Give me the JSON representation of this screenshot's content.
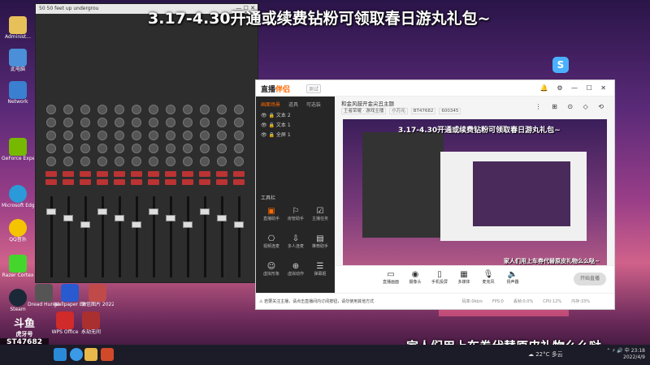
{
  "overlay": {
    "top_banner": "3.17-4.30开通或续费钻粉可领取春日游丸礼包~",
    "bottom_banner": "家人们用上车券代替原皮礼物么么哒~"
  },
  "desktop_icons": [
    {
      "label": "Administ...",
      "icon": "user-folder-icon",
      "color": "#e8c05a"
    },
    {
      "label": "此电脑",
      "icon": "computer-icon",
      "color": "#4a8fd8"
    },
    {
      "label": "Network",
      "icon": "network-icon",
      "color": "#3a7fd0"
    },
    {
      "label": "GeForce Experience",
      "icon": "nvidia-icon",
      "color": "#76b900"
    },
    {
      "label": "Microsoft Edge",
      "icon": "edge-icon",
      "color": "#2a9ad8"
    },
    {
      "label": "QQ音乐",
      "icon": "qq-music-icon",
      "color": "#f5c400"
    },
    {
      "label": "Razer Cortex",
      "icon": "razer-icon",
      "color": "#44d62c"
    },
    {
      "label": "Steam",
      "icon": "steam-icon",
      "color": "#1b2838"
    }
  ],
  "desktop_icons_row2": [
    {
      "label": "Dread Hunger",
      "icon": "game-icon",
      "color": "#555"
    },
    {
      "label": "Wallpaper Engine",
      "icon": "wallpaper-icon",
      "color": "#2a5ad0"
    },
    {
      "label": "微信图片 2022021...",
      "icon": "image-icon",
      "color": "#c04a4a"
    },
    {
      "label": "WPS Office",
      "icon": "wps-icon",
      "color": "#d02a2a"
    },
    {
      "label": "永劫无间",
      "icon": "naraka-icon",
      "color": "#aa3030"
    }
  ],
  "mixer": {
    "title": "50 50 feet up undergrou",
    "window_controls": "—  ☐  ✕"
  },
  "app": {
    "logo_main": "直播",
    "logo_accent": "伴侣",
    "version": "测试",
    "top_icons": "🔔 ⚙ — ☐ ✕",
    "side_tabs": [
      "画面场景",
      "道具",
      "可选装"
    ],
    "scenes": [
      "文本 2",
      "文本 1",
      "全屏 1"
    ],
    "tools_header": "工具栏",
    "tools": [
      {
        "label": "直播助手",
        "icon": "broadcast-icon"
      },
      {
        "label": "房管助手",
        "icon": "manager-icon"
      },
      {
        "label": "主播任务",
        "icon": "task-icon"
      },
      {
        "label": "视频连麦",
        "icon": "video-link-icon"
      },
      {
        "label": "多人连麦",
        "icon": "multi-link-icon"
      },
      {
        "label": "推荐助手",
        "icon": "recommend-icon"
      },
      {
        "label": "虚拟形象",
        "icon": "avatar-icon"
      },
      {
        "label": "虚拟动作",
        "icon": "motion-icon"
      },
      {
        "label": "弹幕姬",
        "icon": "danmaku-icon"
      }
    ],
    "room_title": "和金风鼓开金尖丑主题",
    "room_tags": [
      "王者荣耀 · 游戏主播",
      "小万元",
      "BT47682",
      "600345"
    ],
    "header_icons": "⋮  ⊞  ⊙  ◇  ⟲",
    "preview_title": "3.17-4.30开通或续费钻粉可领取春日游丸礼包~",
    "preview_sub": "家人们用上车券代替原皮礼物么么哒~",
    "bottom_buttons": [
      {
        "label": "直播画面",
        "icon": "screen-icon"
      },
      {
        "label": "摄像头",
        "icon": "camera-icon"
      },
      {
        "label": "手机投屏",
        "icon": "phone-cast-icon"
      },
      {
        "label": "多媒体",
        "icon": "media-icon"
      },
      {
        "label": "麦克风",
        "icon": "mic-icon"
      },
      {
        "label": "扬声器",
        "icon": "speaker-icon"
      }
    ],
    "start_live": "开始直播",
    "notice": "⚠ 若要关注主播，请点击直播间内订阅按钮，请勿使用其他方式",
    "stats": [
      "码率:0kb/s",
      "FPS:0",
      "丢帧:0.0%",
      "CPU:12%",
      "内存:33%"
    ]
  },
  "taskbar": {
    "weather": "☁ 22°C 多云",
    "time": "23:18",
    "date": "2022/4/9",
    "tray_icons": "⌃ ⚡ 🔊 中"
  },
  "room_badge": {
    "logo": "斗鱼",
    "name": "虎牙号",
    "id": "ST47682"
  },
  "colors": {
    "accent": "#ff6a00",
    "desktop_top": "#2a1548",
    "desktop_glow": "#d0628a"
  }
}
